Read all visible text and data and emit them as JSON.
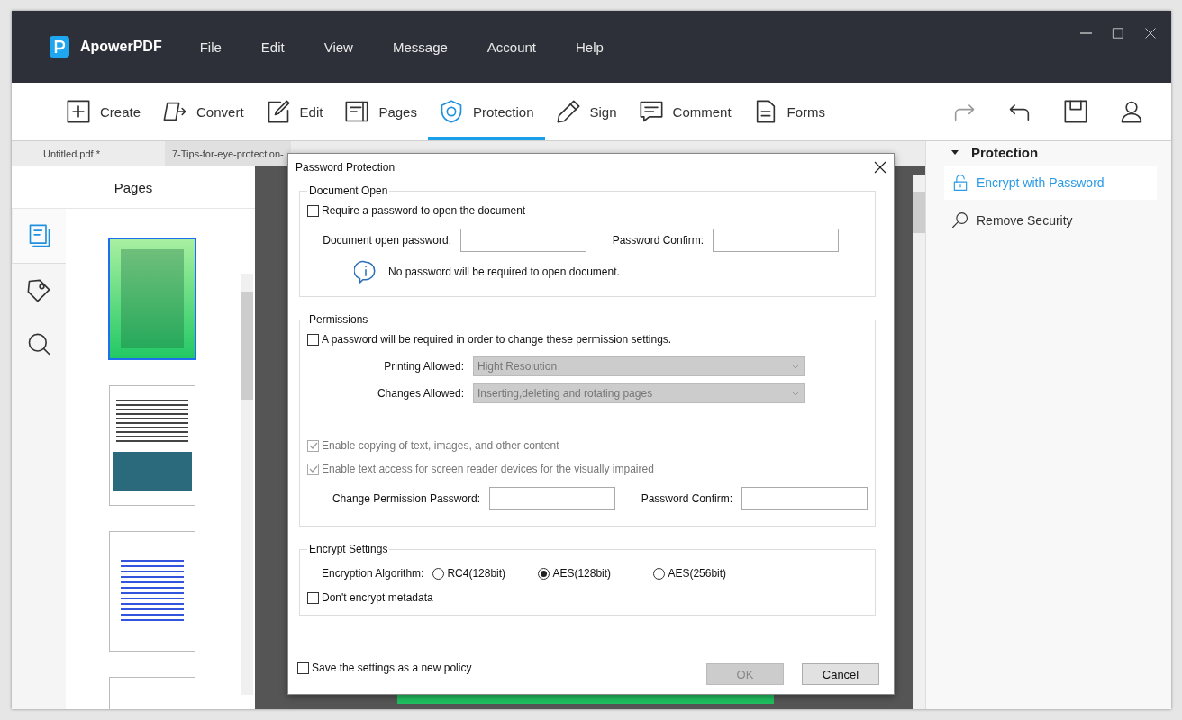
{
  "app": {
    "name": "ApowerPDF",
    "menu": [
      "File",
      "Edit",
      "View",
      "Message",
      "Account",
      "Help"
    ]
  },
  "toolbar": [
    {
      "kind": "create",
      "label": "Create",
      "selected": false
    },
    {
      "kind": "convert",
      "label": "Convert",
      "selected": false
    },
    {
      "kind": "edit",
      "label": "Edit",
      "selected": false
    },
    {
      "kind": "pages",
      "label": "Pages",
      "selected": false
    },
    {
      "kind": "protection",
      "label": "Protection",
      "selected": true
    },
    {
      "kind": "sign",
      "label": "Sign",
      "selected": false
    },
    {
      "kind": "comment",
      "label": "Comment",
      "selected": false
    },
    {
      "kind": "forms",
      "label": "Forms",
      "selected": false
    }
  ],
  "doc_tabs": [
    {
      "label": "Untitled.pdf *",
      "selected": false
    },
    {
      "label": "7-Tips-for-eye-protection-",
      "selected": true
    }
  ],
  "left_panel": {
    "title": "Pages",
    "side_tabs": [
      {
        "kind": "pages",
        "selected": true
      },
      {
        "kind": "tag",
        "selected": false
      },
      {
        "kind": "search",
        "selected": false
      }
    ],
    "thumbnails": [
      {
        "kind": "cover",
        "selected": true
      },
      {
        "kind": "text",
        "selected": false
      },
      {
        "kind": "contents",
        "selected": false
      },
      {
        "kind": "blank",
        "selected": false
      }
    ]
  },
  "right_panel": {
    "title": "Protection",
    "expanded": true,
    "items": [
      {
        "kind": "lock",
        "label": "Encrypt with Password",
        "selected": true
      },
      {
        "kind": "search",
        "label": "Remove Security",
        "selected": false
      }
    ]
  },
  "dialog": {
    "title": "Password Protection",
    "document_open": {
      "title": "Document Open",
      "checkbox": {
        "label": "Require a password to open the document",
        "checked": false
      },
      "fields": [
        {
          "label": "Document open password:"
        },
        {
          "label": "Password Confirm:"
        }
      ],
      "info": "No password will be required to open document."
    },
    "permissions": {
      "title": "Permissions",
      "checkbox": {
        "label": "A password will be required in order to change these permission settings.",
        "checked": false
      },
      "dropdowns": [
        {
          "label": "Printing Allowed:",
          "value": "Hight Resolution",
          "disabled": true
        },
        {
          "label": "Changes Allowed:",
          "value": "Inserting,deleting and rotating pages",
          "disabled": true
        }
      ],
      "options": [
        {
          "label": "Enable copying of text, images, and other content",
          "checked": true,
          "disabled": true
        },
        {
          "label": "Enable text access for screen reader devices for the visually impaired",
          "checked": true,
          "disabled": true
        }
      ],
      "fields": [
        {
          "label": "Change Permission Password:"
        },
        {
          "label": "Password Confirm:"
        }
      ]
    },
    "encrypt": {
      "title": "Encrypt Settings",
      "algorithm_label": "Encryption Algorithm:",
      "options": [
        {
          "label": "RC4(128bit)",
          "selected": false
        },
        {
          "label": "AES(128bit)",
          "selected": true
        },
        {
          "label": "AES(256bit)",
          "selected": false
        }
      ],
      "checkbox": {
        "label": "Don't encrypt metadata",
        "checked": false
      }
    },
    "save_policy": {
      "label": "Save the settings as a new policy",
      "checked": false
    },
    "buttons": [
      {
        "label": "OK",
        "disabled": true
      },
      {
        "label": "Cancel",
        "disabled": false
      }
    ]
  }
}
